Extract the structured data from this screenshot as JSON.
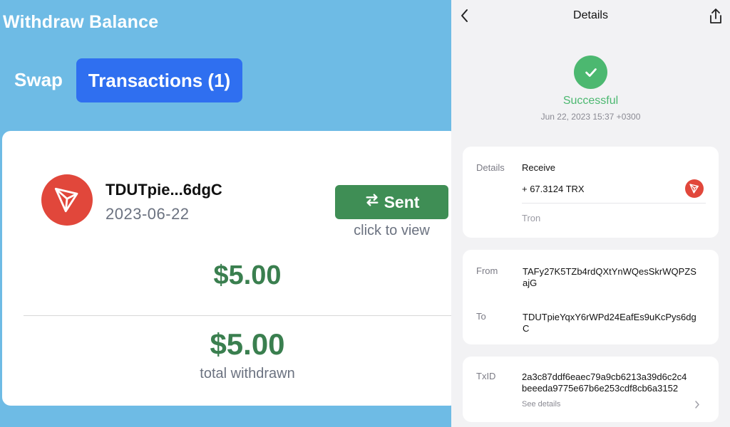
{
  "withdraw": {
    "title": "Withdraw Balance",
    "tabs": {
      "swap": "Swap",
      "transactions": "Transactions (1)"
    },
    "transaction": {
      "address": "TDUTpie...6dgC",
      "date": "2023-06-22",
      "status_button": "Sent",
      "hint": "click to view",
      "amount": "$5.00"
    },
    "total": {
      "amount": "$5.00",
      "label": "total withdrawn"
    },
    "colors": {
      "background": "#6ebbe5",
      "tab_active": "#2f6ff0",
      "sent": "#3f8e55",
      "amount": "#3a7f4f",
      "tron": "#e1473b"
    }
  },
  "details": {
    "header": {
      "title": "Details"
    },
    "status": "Successful",
    "timestamp": "Jun 22, 2023 15:37 +0300",
    "summary": {
      "label": "Details",
      "type": "Receive",
      "amount": "+ 67.3124 TRX",
      "network": "Tron"
    },
    "from": {
      "label": "From",
      "line1": "TAFy27K5TZb4rdQXtYnWQesSkrWQPZS",
      "line2": "ajG"
    },
    "to": {
      "label": "To",
      "line1": "TDUTpieYqxY6rWPd24EafEs9uKcPys6dg",
      "line2": "C"
    },
    "txid": {
      "label": "TxID",
      "line1": "2a3c87ddf6eaec79a9cb6213a39d6c2c4",
      "line2": "beeeda9775e67b6e253cdf8cb6a3152"
    },
    "see_details": "See details",
    "colors": {
      "success": "#4cb870",
      "panel": "#f2f2f4"
    },
    "icons": [
      "back-chevron-icon",
      "share-icon",
      "checkmark-icon",
      "tron-icon",
      "chevron-right-icon"
    ]
  }
}
